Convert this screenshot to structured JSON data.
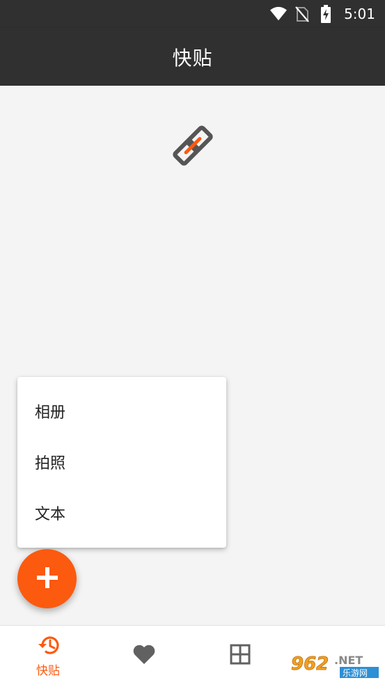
{
  "status_bar": {
    "time": "5:01",
    "icons": [
      "wifi-icon",
      "no-sim-icon",
      "battery-charging-icon"
    ]
  },
  "app_bar": {
    "title": "快贴"
  },
  "main": {
    "center_icon": "link-icon"
  },
  "popup_menu": {
    "items": [
      {
        "label": "相册"
      },
      {
        "label": "拍照"
      },
      {
        "label": "文本"
      }
    ]
  },
  "fab": {
    "icon": "plus-icon"
  },
  "bottom_nav": {
    "items": [
      {
        "icon": "history-icon",
        "label": "快贴",
        "active": true
      },
      {
        "icon": "heart-icon",
        "label": "",
        "active": false
      },
      {
        "icon": "grid-icon",
        "label": "",
        "active": false
      }
    ]
  },
  "watermark": {
    "text": "962.NET 乐游网"
  },
  "colors": {
    "accent": "#fb5a0f",
    "app_bar": "#303030",
    "background": "#f4f4f4",
    "icon_gray": "#616161"
  }
}
